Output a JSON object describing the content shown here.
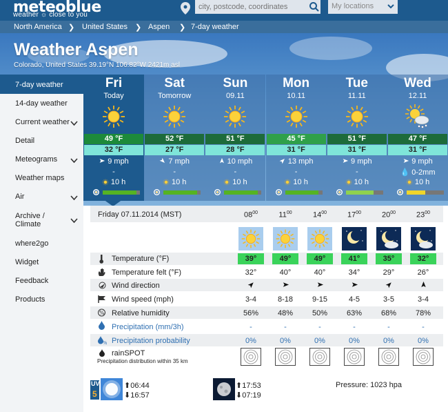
{
  "header": {
    "logo": "meteoblue",
    "logo_sub": "weather ☼ close to you",
    "search_placeholder": "city, postcode, coordinates",
    "my_locations": "My locations"
  },
  "breadcrumbs": [
    "North America",
    "United States",
    "Aspen",
    "7-day weather"
  ],
  "title": "Weather Aspen",
  "subtitle": "Colorado, United States 39.19°N 106.82°W 2421m asl",
  "sidebar": [
    {
      "label": "7-day weather",
      "active": true
    },
    {
      "label": "14-day weather"
    },
    {
      "label": "Current weather",
      "chevron": true
    },
    {
      "label": "Detail"
    },
    {
      "label": "Meteograms",
      "chevron": true
    },
    {
      "label": "Weather maps"
    },
    {
      "label": "Air",
      "chevron": true
    },
    {
      "label": "Archive / Climate",
      "label1": "Archive /",
      "label2": "Climate",
      "chevron": true
    },
    {
      "label": "where2go"
    },
    {
      "label": "Widget"
    },
    {
      "label": "Feedback"
    },
    {
      "label": "Products"
    }
  ],
  "days": [
    {
      "name": "Fri",
      "sub": "Today",
      "icon": "sun-icon",
      "max": "49 °F",
      "min": "32 °F",
      "wind": "9 mph",
      "wind_dir": "east",
      "precip": "-",
      "sun": "10 h",
      "sun_fraction": 0.9,
      "max_color": "#1d8a3a"
    },
    {
      "name": "Sat",
      "sub": "Tomorrow",
      "icon": "sun-icon",
      "max": "52 °F",
      "min": "27 °F",
      "wind": "7 mph",
      "wind_dir": "southeast",
      "precip": "-",
      "sun": "10 h",
      "sun_fraction": 0.9,
      "max_color": "#1d6b3a"
    },
    {
      "name": "Sun",
      "sub": "09.11",
      "icon": "sun-icon",
      "max": "51 °F",
      "min": "28 °F",
      "wind": "10 mph",
      "wind_dir": "north",
      "precip": "-",
      "sun": "10 h",
      "sun_fraction": 0.9,
      "max_color": "#1d6b3a"
    },
    {
      "name": "Mon",
      "sub": "10.11",
      "icon": "sun-icon",
      "max": "45 °F",
      "min": "31 °F",
      "wind": "13 mph",
      "wind_dir": "northeast",
      "precip": "-",
      "sun": "10 h",
      "sun_fraction": 0.9,
      "max_color": "#2fa04a"
    },
    {
      "name": "Tue",
      "sub": "11.11",
      "icon": "sun-icon",
      "max": "51 °F",
      "min": "31 °F",
      "wind": "9 mph",
      "wind_dir": "east",
      "precip": "-",
      "sun": "10 h",
      "sun_fraction": 0.75,
      "max_color": "#1d6b3a"
    },
    {
      "name": "Wed",
      "sub": "12.11",
      "icon": "sun-cloud-snow-icon",
      "max": "47 °F",
      "min": "31 °F",
      "wind": "9 mph",
      "wind_dir": "east",
      "precip": "0-2mm",
      "sun": "10 h",
      "sun_fraction": 0.5,
      "max_color": "#1d6b3a"
    }
  ],
  "detail": {
    "date_label": "Friday 07.11.2014 (MST)",
    "hours": [
      {
        "h": "08",
        "m": "00"
      },
      {
        "h": "11",
        "m": "00"
      },
      {
        "h": "14",
        "m": "00"
      },
      {
        "h": "17",
        "m": "00"
      },
      {
        "h": "20",
        "m": "00"
      },
      {
        "h": "23",
        "m": "00"
      }
    ],
    "icons": [
      "sun-icon",
      "sun-icon",
      "sun-icon",
      "moon-icon",
      "moon-cloud-icon",
      "moon-cloud-icon"
    ],
    "temperature_label": "Temperature (°F)",
    "temperature": [
      "39°",
      "49°",
      "49°",
      "41°",
      "35°",
      "32°"
    ],
    "felt_label": "Temperature felt (°F)",
    "felt": [
      "32°",
      "40°",
      "40°",
      "34°",
      "29°",
      "26°"
    ],
    "wind_dir_label": "Wind direction",
    "wind_dirs": [
      "northeast",
      "east",
      "east",
      "east",
      "northeast",
      "north"
    ],
    "wind_speed_label": "Wind speed (mph)",
    "wind_speed": [
      "3-4",
      "8-18",
      "9-15",
      "4-5",
      "3-5",
      "3-4"
    ],
    "humidity_label": "Relative humidity",
    "humidity": [
      "56%",
      "48%",
      "50%",
      "63%",
      "68%",
      "78%"
    ],
    "precip_label": "Precipitation (mm/3h)",
    "precip": [
      "-",
      "-",
      "-",
      "-",
      "-",
      "-"
    ],
    "precip_prob_label": "Precipitation probability",
    "precip_prob": [
      "0%",
      "0%",
      "0%",
      "0%",
      "0%",
      "0%"
    ],
    "rainspot_label": "rainSPOT",
    "rainspot_sub": "Precipitation distribution within 35 km"
  },
  "footer": {
    "uv_label": "UV",
    "uv_value": "5",
    "sunrise": "06:44",
    "sunset": "16:57",
    "moonrise": "17:53",
    "moonset": "07:19",
    "pressure": "Pressure: 1023 hpa"
  },
  "colors": {
    "brand": "#1d5a8e",
    "temp_warm": "#3ad35a",
    "temp_min": "#7fe5d9"
  }
}
